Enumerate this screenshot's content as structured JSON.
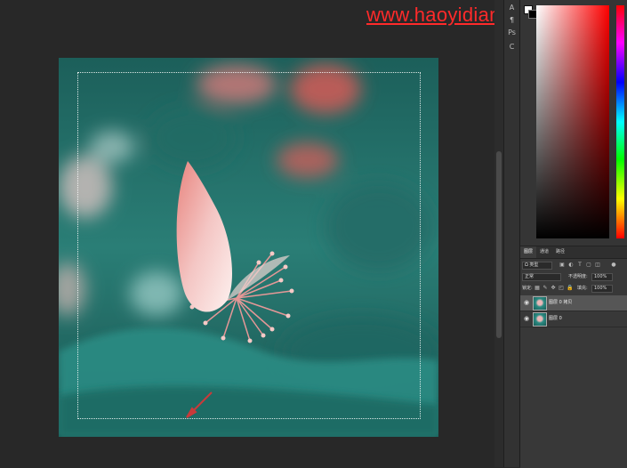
{
  "watermark": {
    "text": "www.haoyidian.zheji.com"
  },
  "toolbar_strip": {
    "items": [
      {
        "label": "A",
        "icon": "character-icon"
      },
      {
        "label": "¶",
        "icon": "paragraph-icon"
      },
      {
        "label": "Ps",
        "icon": "properties-icon"
      },
      {
        "label": "C",
        "icon": "color-icon"
      }
    ]
  },
  "color_picker": {
    "hue": "#ff0000",
    "foreground": "#ffffff",
    "background": "#000000"
  },
  "layers_panel": {
    "tabs": [
      "图层",
      "通道",
      "路径"
    ],
    "active_tab": 0,
    "filter_label": "Ω 类型",
    "blend_mode": "正常",
    "opacity_label": "不透明度:",
    "opacity_value": "100%",
    "lock_label": "锁定:",
    "fill_label": "填充:",
    "fill_value": "100%",
    "layers": [
      {
        "name": "图层 0 拷贝",
        "selected": true,
        "visible": true
      },
      {
        "name": "图层 0",
        "selected": false,
        "visible": true
      }
    ]
  },
  "canvas": {
    "accent_teal": "#1f6f68",
    "petal_pink": "#f0b4b4",
    "arrow_color": "#c83a3a"
  }
}
